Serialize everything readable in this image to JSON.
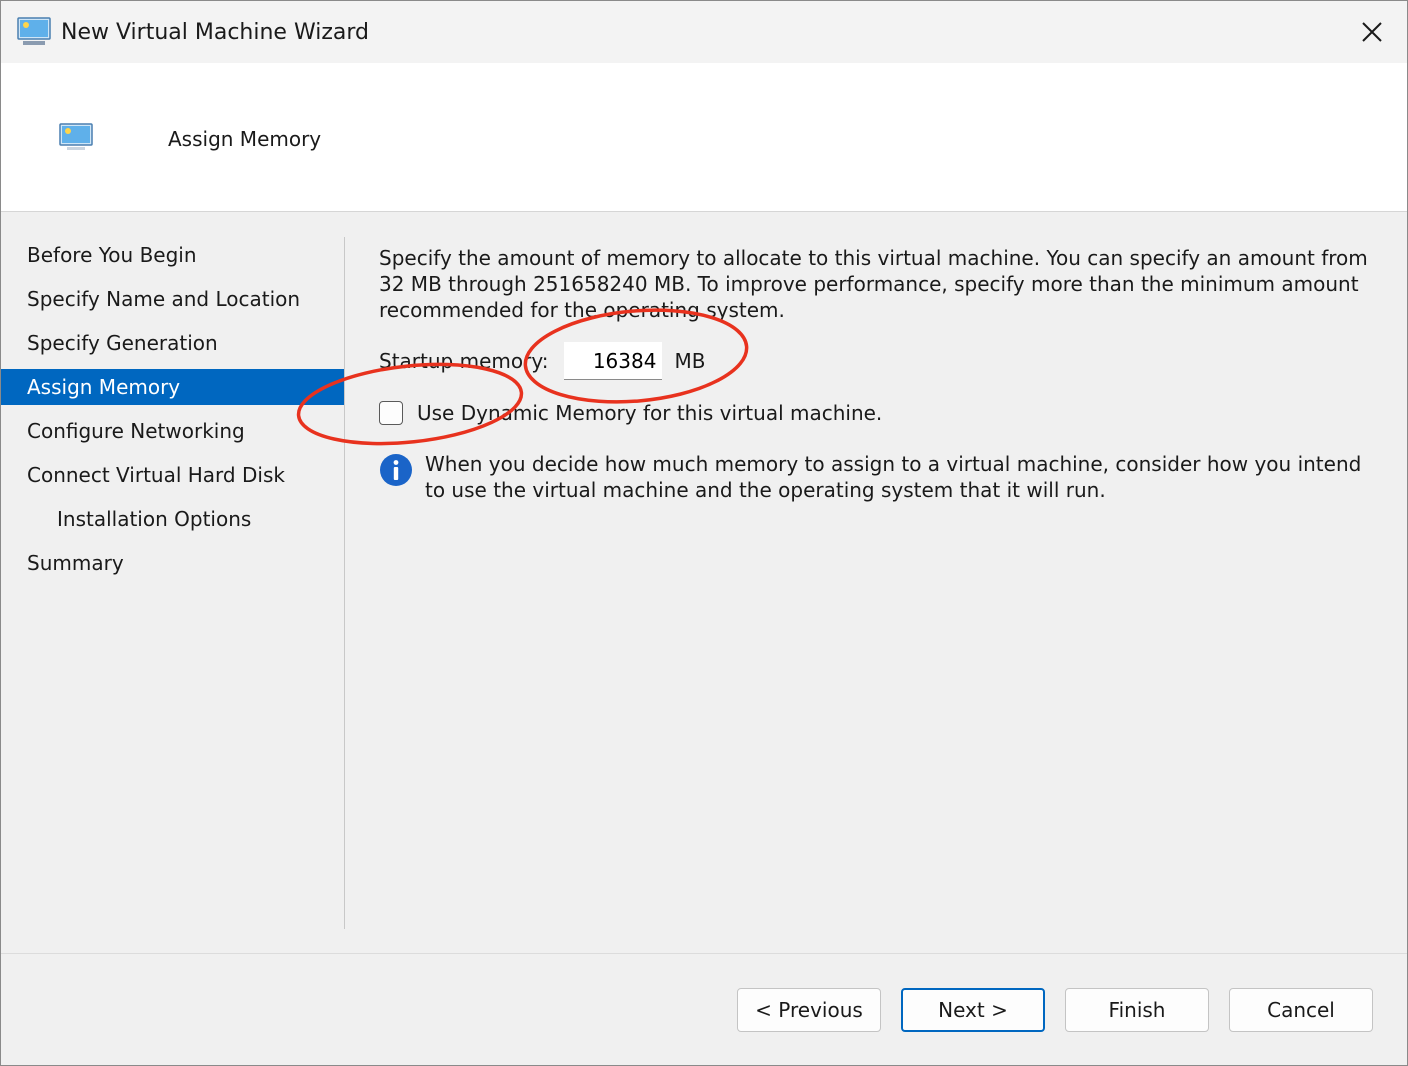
{
  "window": {
    "title": "New Virtual Machine Wizard",
    "icon": "monitor-icon"
  },
  "header": {
    "title": "Assign Memory",
    "icon": "monitor-icon"
  },
  "nav": {
    "items": [
      {
        "label": "Before You Begin",
        "active": false
      },
      {
        "label": "Specify Name and Location",
        "active": false
      },
      {
        "label": "Specify Generation",
        "active": false
      },
      {
        "label": "Assign Memory",
        "active": true
      },
      {
        "label": "Configure Networking",
        "active": false
      },
      {
        "label": "Connect Virtual Hard Disk",
        "active": false
      },
      {
        "label": "Installation Options",
        "active": false
      },
      {
        "label": "Summary",
        "active": false
      }
    ]
  },
  "content": {
    "description": "Specify the amount of memory to allocate to this virtual machine. You can specify an amount from 32 MB through 251658240 MB. To improve performance, specify more than the minimum amount recommended for the operating system.",
    "startup_memory_label": "Startup memory:",
    "startup_memory_value": "16384",
    "startup_memory_unit": "MB",
    "dynamic_memory_label": "Use Dynamic Memory for this virtual machine.",
    "dynamic_memory_checked": false,
    "info_text": "When you decide how much memory to assign to a virtual machine, consider how you intend to use the virtual machine and the operating system that it will run."
  },
  "buttons": {
    "previous": "< Previous",
    "next": "Next >",
    "finish": "Finish",
    "cancel": "Cancel"
  },
  "colors": {
    "accent": "#0067c0",
    "annotation": "#e8321e",
    "info": "#1a64c8"
  }
}
